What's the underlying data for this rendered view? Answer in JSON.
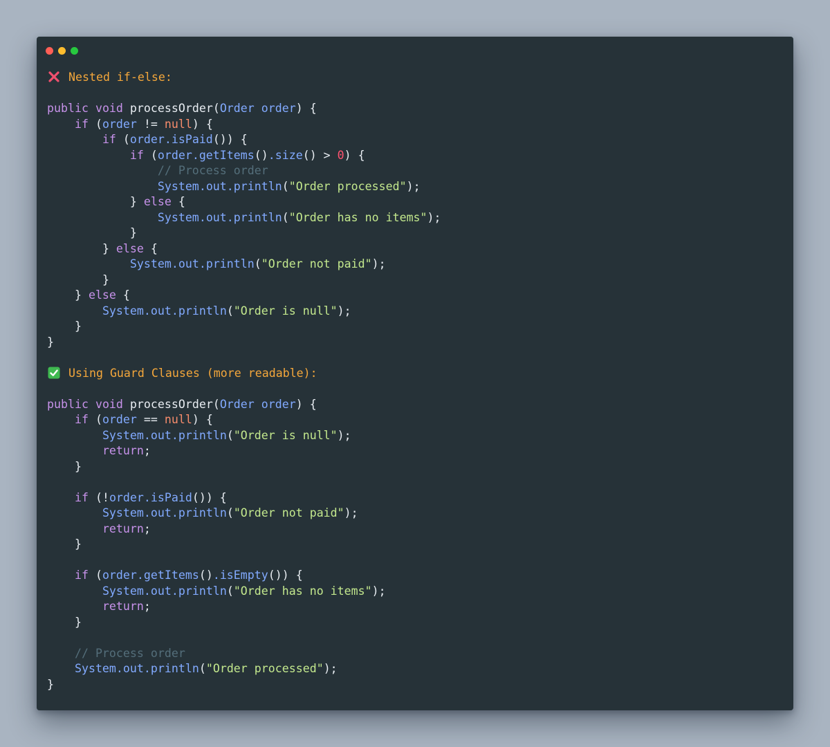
{
  "window": {
    "controls": [
      {
        "name": "close-button",
        "color": "#ff5f56"
      },
      {
        "name": "minimize-button",
        "color": "#ffbd2e"
      },
      {
        "name": "maximize-button",
        "color": "#27c93f"
      }
    ]
  },
  "code": {
    "icons": {
      "bad": "cross-mark-icon",
      "good": "check-mark-icon"
    },
    "lines": [
      [
        {
          "c": "heading",
          "t": "Nested if-else:",
          "icon": "bad"
        }
      ],
      [],
      [
        {
          "c": "kw",
          "t": "public"
        },
        {
          "c": "plain",
          "t": " "
        },
        {
          "c": "kw",
          "t": "void"
        },
        {
          "c": "plain",
          "t": " "
        },
        {
          "c": "fn",
          "t": "processOrder"
        },
        {
          "c": "punct",
          "t": "("
        },
        {
          "c": "type",
          "t": "Order"
        },
        {
          "c": "plain",
          "t": " "
        },
        {
          "c": "param",
          "t": "order"
        },
        {
          "c": "punct",
          "t": ") {"
        }
      ],
      [
        {
          "c": "plain",
          "t": "    "
        },
        {
          "c": "kw",
          "t": "if"
        },
        {
          "c": "punct",
          "t": " ("
        },
        {
          "c": "param",
          "t": "order"
        },
        {
          "c": "plain",
          "t": " "
        },
        {
          "c": "punct",
          "t": "!="
        },
        {
          "c": "plain",
          "t": " "
        },
        {
          "c": "lit",
          "t": "null"
        },
        {
          "c": "punct",
          "t": ") {"
        }
      ],
      [
        {
          "c": "plain",
          "t": "        "
        },
        {
          "c": "kw",
          "t": "if"
        },
        {
          "c": "punct",
          "t": " ("
        },
        {
          "c": "param",
          "t": "order"
        },
        {
          "c": "sym",
          "t": "."
        },
        {
          "c": "method",
          "t": "isPaid"
        },
        {
          "c": "punct",
          "t": "()) {"
        }
      ],
      [
        {
          "c": "plain",
          "t": "            "
        },
        {
          "c": "kw",
          "t": "if"
        },
        {
          "c": "punct",
          "t": " ("
        },
        {
          "c": "param",
          "t": "order"
        },
        {
          "c": "sym",
          "t": "."
        },
        {
          "c": "method",
          "t": "getItems"
        },
        {
          "c": "punct",
          "t": "()"
        },
        {
          "c": "sym",
          "t": "."
        },
        {
          "c": "method",
          "t": "size"
        },
        {
          "c": "punct",
          "t": "() > "
        },
        {
          "c": "num",
          "t": "0"
        },
        {
          "c": "punct",
          "t": ") {"
        }
      ],
      [
        {
          "c": "plain",
          "t": "                "
        },
        {
          "c": "comment",
          "t": "// Process order"
        }
      ],
      [
        {
          "c": "plain",
          "t": "                "
        },
        {
          "c": "method",
          "t": "System"
        },
        {
          "c": "sym",
          "t": "."
        },
        {
          "c": "method",
          "t": "out"
        },
        {
          "c": "sym",
          "t": "."
        },
        {
          "c": "method",
          "t": "println"
        },
        {
          "c": "punct",
          "t": "("
        },
        {
          "c": "str",
          "t": "\"Order processed\""
        },
        {
          "c": "punct",
          "t": ");"
        }
      ],
      [
        {
          "c": "plain",
          "t": "            "
        },
        {
          "c": "punct",
          "t": "} "
        },
        {
          "c": "kw",
          "t": "else"
        },
        {
          "c": "punct",
          "t": " {"
        }
      ],
      [
        {
          "c": "plain",
          "t": "                "
        },
        {
          "c": "method",
          "t": "System"
        },
        {
          "c": "sym",
          "t": "."
        },
        {
          "c": "method",
          "t": "out"
        },
        {
          "c": "sym",
          "t": "."
        },
        {
          "c": "method",
          "t": "println"
        },
        {
          "c": "punct",
          "t": "("
        },
        {
          "c": "str",
          "t": "\"Order has no items\""
        },
        {
          "c": "punct",
          "t": ");"
        }
      ],
      [
        {
          "c": "plain",
          "t": "            "
        },
        {
          "c": "punct",
          "t": "}"
        }
      ],
      [
        {
          "c": "plain",
          "t": "        "
        },
        {
          "c": "punct",
          "t": "} "
        },
        {
          "c": "kw",
          "t": "else"
        },
        {
          "c": "punct",
          "t": " {"
        }
      ],
      [
        {
          "c": "plain",
          "t": "            "
        },
        {
          "c": "method",
          "t": "System"
        },
        {
          "c": "sym",
          "t": "."
        },
        {
          "c": "method",
          "t": "out"
        },
        {
          "c": "sym",
          "t": "."
        },
        {
          "c": "method",
          "t": "println"
        },
        {
          "c": "punct",
          "t": "("
        },
        {
          "c": "str",
          "t": "\"Order not paid\""
        },
        {
          "c": "punct",
          "t": ");"
        }
      ],
      [
        {
          "c": "plain",
          "t": "        "
        },
        {
          "c": "punct",
          "t": "}"
        }
      ],
      [
        {
          "c": "plain",
          "t": "    "
        },
        {
          "c": "punct",
          "t": "} "
        },
        {
          "c": "kw",
          "t": "else"
        },
        {
          "c": "punct",
          "t": " {"
        }
      ],
      [
        {
          "c": "plain",
          "t": "        "
        },
        {
          "c": "method",
          "t": "System"
        },
        {
          "c": "sym",
          "t": "."
        },
        {
          "c": "method",
          "t": "out"
        },
        {
          "c": "sym",
          "t": "."
        },
        {
          "c": "method",
          "t": "println"
        },
        {
          "c": "punct",
          "t": "("
        },
        {
          "c": "str",
          "t": "\"Order is null\""
        },
        {
          "c": "punct",
          "t": ");"
        }
      ],
      [
        {
          "c": "plain",
          "t": "    "
        },
        {
          "c": "punct",
          "t": "}"
        }
      ],
      [
        {
          "c": "punct",
          "t": "}"
        }
      ],
      [],
      [
        {
          "c": "heading",
          "t": "Using Guard Clauses (more readable):",
          "icon": "good"
        }
      ],
      [],
      [
        {
          "c": "kw",
          "t": "public"
        },
        {
          "c": "plain",
          "t": " "
        },
        {
          "c": "kw",
          "t": "void"
        },
        {
          "c": "plain",
          "t": " "
        },
        {
          "c": "fn",
          "t": "processOrder"
        },
        {
          "c": "punct",
          "t": "("
        },
        {
          "c": "type",
          "t": "Order"
        },
        {
          "c": "plain",
          "t": " "
        },
        {
          "c": "param",
          "t": "order"
        },
        {
          "c": "punct",
          "t": ") {"
        }
      ],
      [
        {
          "c": "plain",
          "t": "    "
        },
        {
          "c": "kw",
          "t": "if"
        },
        {
          "c": "punct",
          "t": " ("
        },
        {
          "c": "param",
          "t": "order"
        },
        {
          "c": "plain",
          "t": " "
        },
        {
          "c": "punct",
          "t": "=="
        },
        {
          "c": "plain",
          "t": " "
        },
        {
          "c": "lit",
          "t": "null"
        },
        {
          "c": "punct",
          "t": ") {"
        }
      ],
      [
        {
          "c": "plain",
          "t": "        "
        },
        {
          "c": "method",
          "t": "System"
        },
        {
          "c": "sym",
          "t": "."
        },
        {
          "c": "method",
          "t": "out"
        },
        {
          "c": "sym",
          "t": "."
        },
        {
          "c": "method",
          "t": "println"
        },
        {
          "c": "punct",
          "t": "("
        },
        {
          "c": "str",
          "t": "\"Order is null\""
        },
        {
          "c": "punct",
          "t": ");"
        }
      ],
      [
        {
          "c": "plain",
          "t": "        "
        },
        {
          "c": "kw",
          "t": "return"
        },
        {
          "c": "punct",
          "t": ";"
        }
      ],
      [
        {
          "c": "plain",
          "t": "    "
        },
        {
          "c": "punct",
          "t": "}"
        }
      ],
      [],
      [
        {
          "c": "plain",
          "t": "    "
        },
        {
          "c": "kw",
          "t": "if"
        },
        {
          "c": "punct",
          "t": " (!"
        },
        {
          "c": "param",
          "t": "order"
        },
        {
          "c": "sym",
          "t": "."
        },
        {
          "c": "method",
          "t": "isPaid"
        },
        {
          "c": "punct",
          "t": "()) {"
        }
      ],
      [
        {
          "c": "plain",
          "t": "        "
        },
        {
          "c": "method",
          "t": "System"
        },
        {
          "c": "sym",
          "t": "."
        },
        {
          "c": "method",
          "t": "out"
        },
        {
          "c": "sym",
          "t": "."
        },
        {
          "c": "method",
          "t": "println"
        },
        {
          "c": "punct",
          "t": "("
        },
        {
          "c": "str",
          "t": "\"Order not paid\""
        },
        {
          "c": "punct",
          "t": ");"
        }
      ],
      [
        {
          "c": "plain",
          "t": "        "
        },
        {
          "c": "kw",
          "t": "return"
        },
        {
          "c": "punct",
          "t": ";"
        }
      ],
      [
        {
          "c": "plain",
          "t": "    "
        },
        {
          "c": "punct",
          "t": "}"
        }
      ],
      [],
      [
        {
          "c": "plain",
          "t": "    "
        },
        {
          "c": "kw",
          "t": "if"
        },
        {
          "c": "punct",
          "t": " ("
        },
        {
          "c": "param",
          "t": "order"
        },
        {
          "c": "sym",
          "t": "."
        },
        {
          "c": "method",
          "t": "getItems"
        },
        {
          "c": "punct",
          "t": "()"
        },
        {
          "c": "sym",
          "t": "."
        },
        {
          "c": "method",
          "t": "isEmpty"
        },
        {
          "c": "punct",
          "t": "()) {"
        }
      ],
      [
        {
          "c": "plain",
          "t": "        "
        },
        {
          "c": "method",
          "t": "System"
        },
        {
          "c": "sym",
          "t": "."
        },
        {
          "c": "method",
          "t": "out"
        },
        {
          "c": "sym",
          "t": "."
        },
        {
          "c": "method",
          "t": "println"
        },
        {
          "c": "punct",
          "t": "("
        },
        {
          "c": "str",
          "t": "\"Order has no items\""
        },
        {
          "c": "punct",
          "t": ");"
        }
      ],
      [
        {
          "c": "plain",
          "t": "        "
        },
        {
          "c": "kw",
          "t": "return"
        },
        {
          "c": "punct",
          "t": ";"
        }
      ],
      [
        {
          "c": "plain",
          "t": "    "
        },
        {
          "c": "punct",
          "t": "}"
        }
      ],
      [],
      [
        {
          "c": "plain",
          "t": "    "
        },
        {
          "c": "comment",
          "t": "// Process order"
        }
      ],
      [
        {
          "c": "plain",
          "t": "    "
        },
        {
          "c": "method",
          "t": "System"
        },
        {
          "c": "sym",
          "t": "."
        },
        {
          "c": "method",
          "t": "out"
        },
        {
          "c": "sym",
          "t": "."
        },
        {
          "c": "method",
          "t": "println"
        },
        {
          "c": "punct",
          "t": "("
        },
        {
          "c": "str",
          "t": "\"Order processed\""
        },
        {
          "c": "punct",
          "t": ");"
        }
      ],
      [
        {
          "c": "punct",
          "t": "}"
        }
      ]
    ]
  }
}
